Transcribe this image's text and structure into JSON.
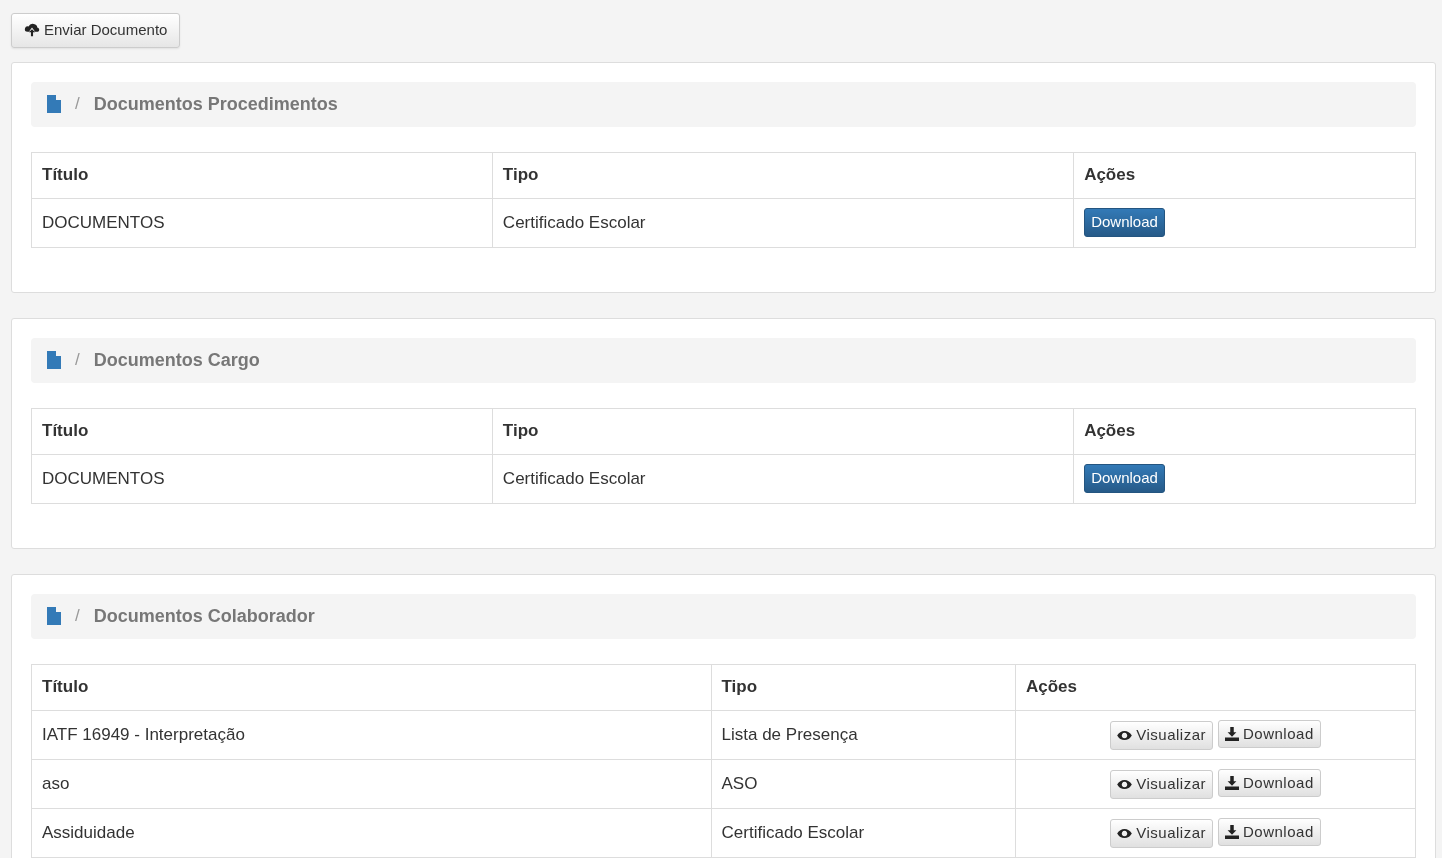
{
  "upload_button": {
    "label": "Enviar Documento"
  },
  "sections": [
    {
      "title": "Documentos Procedimentos",
      "separator": "/",
      "columns": [
        "Título",
        "Tipo",
        "Ações"
      ],
      "rows": [
        {
          "cells": [
            "DOCUMENTOS",
            "Certificado Escolar"
          ],
          "actions": [
            {
              "kind": "primary",
              "label": "Download"
            }
          ]
        }
      ]
    },
    {
      "title": "Documentos Cargo",
      "separator": "/",
      "columns": [
        "Título",
        "Tipo",
        "Ações"
      ],
      "rows": [
        {
          "cells": [
            "DOCUMENTOS",
            "Certificado Escolar"
          ],
          "actions": [
            {
              "kind": "primary",
              "label": "Download"
            }
          ]
        }
      ]
    },
    {
      "title": "Documentos Colaborador",
      "separator": "/",
      "columns": [
        "Título",
        "Tipo",
        "Ações"
      ],
      "rows": [
        {
          "cells": [
            "IATF 16949 - Interpretação",
            "Lista de Presença"
          ],
          "actions": [
            {
              "kind": "view",
              "label": "Visualizar"
            },
            {
              "kind": "download",
              "label": "Download"
            }
          ]
        },
        {
          "cells": [
            "aso",
            "ASO"
          ],
          "actions": [
            {
              "kind": "view",
              "label": "Visualizar"
            },
            {
              "kind": "download",
              "label": "Download"
            }
          ]
        },
        {
          "cells": [
            "Assiduidade",
            "Certificado Escolar"
          ],
          "actions": [
            {
              "kind": "view",
              "label": "Visualizar"
            },
            {
              "kind": "download",
              "label": "Download"
            }
          ]
        }
      ]
    }
  ]
}
